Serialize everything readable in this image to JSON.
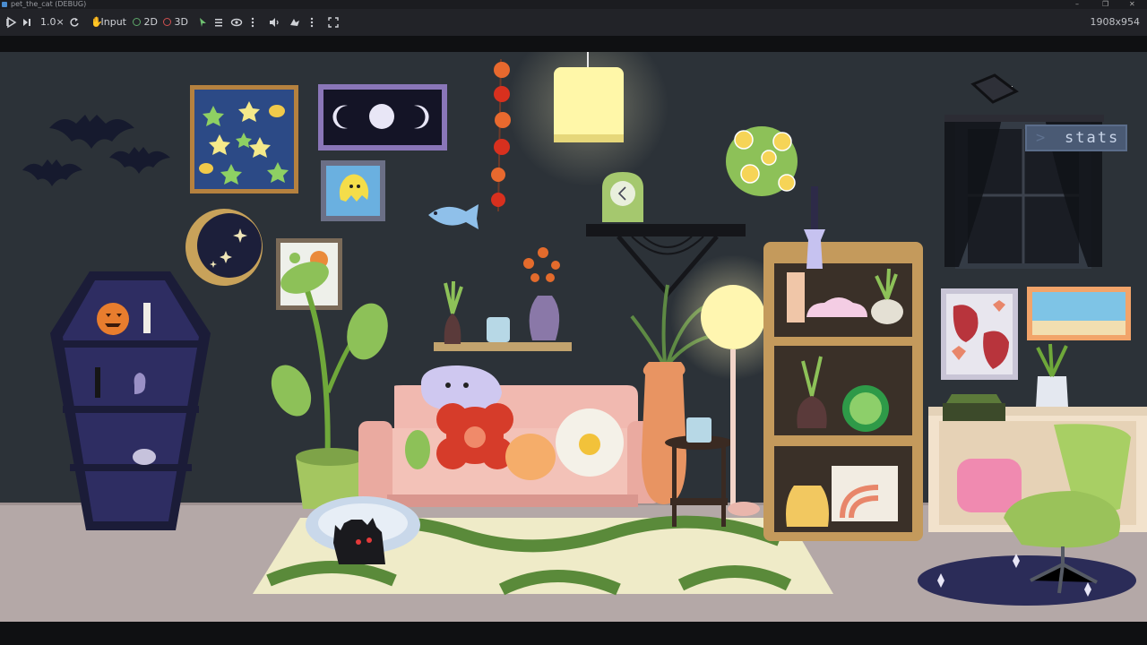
{
  "window": {
    "title": "pet_the_cat (DEBUG)"
  },
  "toolbar": {
    "speed": "1.0×",
    "input_label": "Input",
    "mode_2d": "2D",
    "mode_3d": "3D",
    "resolution": "1908x954"
  },
  "game": {
    "stats_label": "stats"
  },
  "colors": {
    "wall": "#2c3238",
    "floor": "#b5a9a8",
    "accent_green": "#8dc158",
    "stats_button": "#4a5a74"
  }
}
